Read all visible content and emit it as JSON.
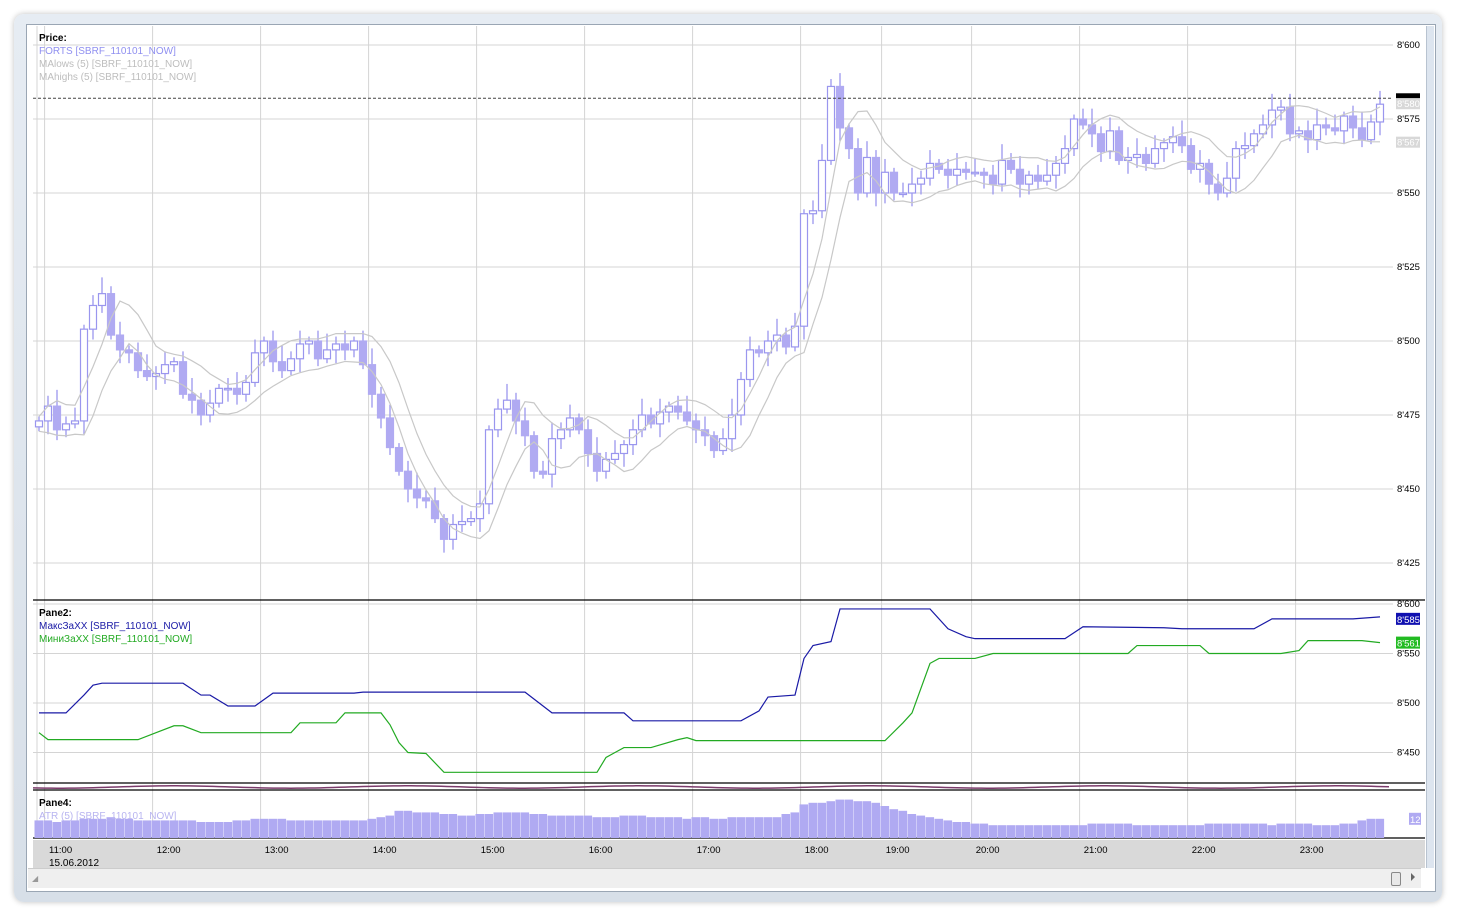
{
  "colors": {
    "candle_up_stroke": "#9a96ee",
    "candle_down_fill": "#b0aaf2",
    "ma": "#c8c8c8",
    "max_line": "#1a1aa6",
    "min_line": "#22aa22",
    "atr": "#b0aaf2",
    "grid": "#d4d4d4"
  },
  "legends": {
    "price": {
      "title": "Price:",
      "items": [
        "FORTS [SBRF_110101_NOW]",
        "MAlows (5) [SBRF_110101_NOW]",
        "MAhighs (5) [SBRF_110101_NOW]"
      ]
    },
    "pane2": {
      "title": "Pane2:",
      "items": [
        "МаксЗаXX [SBRF_110101_NOW]",
        "МиниЗаXX [SBRF_110101_NOW]"
      ]
    },
    "pane4": {
      "title": "Pane4:",
      "items": [
        "ATR (5) [SBRF_110101_NOW]"
      ]
    }
  },
  "chart_data": [
    {
      "type": "candlestick",
      "name": "Price",
      "y_ticks": [
        "8'600",
        "8'575",
        "8'550",
        "8'525",
        "8'500",
        "8'475",
        "8'450",
        "8'425"
      ],
      "y_tick_values": [
        8600,
        8575,
        8550,
        8525,
        8500,
        8475,
        8450,
        8425
      ],
      "ylim": [
        8418,
        8606
      ],
      "current_price": 8582,
      "markers": [
        {
          "label": "8'580",
          "value": 8580
        },
        {
          "label": "8'575",
          "value": 8575
        },
        {
          "label": "8'567",
          "value": 8567
        }
      ],
      "close": [
        8473,
        8478,
        8470,
        8472,
        8473,
        8504,
        8512,
        8516,
        8502,
        8497,
        8496,
        8490,
        8488,
        8489,
        8492,
        8493,
        8482,
        8480,
        8475,
        8479,
        8484,
        8484,
        8482,
        8486,
        8496,
        8500,
        8493,
        8490,
        8494,
        8499,
        8500,
        8494,
        8497,
        8499,
        8497,
        8500,
        8492,
        8482,
        8474,
        8464,
        8456,
        8450,
        8447,
        8446,
        8440,
        8433,
        8438,
        8439,
        8440,
        8445,
        8470,
        8477,
        8480,
        8473,
        8468,
        8456,
        8455,
        8467,
        8470,
        8474,
        8470,
        8462,
        8456,
        8460,
        8462,
        8465,
        8470,
        8475,
        8472,
        8476,
        8478,
        8476,
        8473,
        8470,
        8468,
        8463,
        8467,
        8475,
        8487,
        8497,
        8496,
        8500,
        8502,
        8498,
        8505,
        8543,
        8544,
        8561,
        8586,
        8572,
        8565,
        8550,
        8562,
        8550,
        8557,
        8550,
        8550,
        8553,
        8555,
        8560,
        8558,
        8556,
        8558,
        8557,
        8557,
        8556,
        8553,
        8561,
        8558,
        8553,
        8556,
        8554,
        8556,
        8560,
        8565,
        8575,
        8573,
        8570,
        8564,
        8571,
        8561,
        8562,
        8563,
        8560,
        8565,
        8567,
        8569,
        8566,
        8558,
        8560,
        8553,
        8550,
        8555,
        8565,
        8566,
        8570,
        8573,
        8578,
        8579,
        8570,
        8571,
        8568,
        8573,
        8572,
        8571,
        8576,
        8572,
        8568,
        8574,
        8580
      ]
    },
    {
      "type": "line",
      "name": "Pane2",
      "y_ticks": [
        "8'600",
        "8'550",
        "8'500",
        "8'450"
      ],
      "y_tick_values": [
        8600,
        8550,
        8500,
        8450
      ],
      "markers": [
        {
          "label": "8'585",
          "value": 8585,
          "series": 0
        },
        {
          "label": "8'561",
          "value": 8561,
          "series": 1
        }
      ],
      "series": [
        {
          "name": "МаксЗаXX",
          "points": [
            [
              0,
              8490
            ],
            [
              3,
              8490
            ],
            [
              5,
              8508
            ],
            [
              6,
              8518
            ],
            [
              7,
              8520
            ],
            [
              16,
              8520
            ],
            [
              18,
              8508
            ],
            [
              19,
              8508
            ],
            [
              21,
              8497
            ],
            [
              24,
              8497
            ],
            [
              26,
              8510
            ],
            [
              35,
              8510
            ],
            [
              36,
              8511
            ],
            [
              54,
              8511
            ],
            [
              57,
              8490
            ],
            [
              65,
              8490
            ],
            [
              66,
              8482
            ],
            [
              78,
              8482
            ],
            [
              80,
              8492
            ],
            [
              81,
              8506
            ],
            [
              84,
              8508
            ],
            [
              85,
              8545
            ],
            [
              86,
              8558
            ],
            [
              88,
              8562
            ],
            [
              89,
              8595
            ],
            [
              99,
              8595
            ],
            [
              101,
              8575
            ],
            [
              103,
              8567
            ],
            [
              104,
              8565
            ],
            [
              114,
              8565
            ],
            [
              116,
              8577
            ],
            [
              125,
              8576
            ],
            [
              127,
              8575
            ],
            [
              135,
              8575
            ],
            [
              137,
              8585
            ],
            [
              146,
              8585
            ],
            [
              149,
              8587
            ]
          ]
        },
        {
          "name": "МиниЗаXX",
          "points": [
            [
              0,
              8470
            ],
            [
              1,
              8463
            ],
            [
              11,
              8463
            ],
            [
              13,
              8470
            ],
            [
              15,
              8477
            ],
            [
              16,
              8477
            ],
            [
              18,
              8470
            ],
            [
              28,
              8470
            ],
            [
              29,
              8480
            ],
            [
              33,
              8480
            ],
            [
              34,
              8490
            ],
            [
              38,
              8490
            ],
            [
              39,
              8478
            ],
            [
              40,
              8460
            ],
            [
              41,
              8450
            ],
            [
              43,
              8449
            ],
            [
              45,
              8430
            ],
            [
              62,
              8430
            ],
            [
              63,
              8445
            ],
            [
              64,
              8450
            ],
            [
              65,
              8455
            ],
            [
              68,
              8455
            ],
            [
              71,
              8463
            ],
            [
              72,
              8465
            ],
            [
              73,
              8462
            ],
            [
              94,
              8462
            ],
            [
              96,
              8480
            ],
            [
              97,
              8490
            ],
            [
              99,
              8540
            ],
            [
              100,
              8545
            ],
            [
              104,
              8545
            ],
            [
              106,
              8550
            ],
            [
              115,
              8550
            ],
            [
              121,
              8550
            ],
            [
              122,
              8558
            ],
            [
              129,
              8558
            ],
            [
              130,
              8550
            ],
            [
              138,
              8550
            ],
            [
              140,
              8553
            ],
            [
              141,
              8563
            ],
            [
              147,
              8563
            ],
            [
              149,
              8561
            ]
          ]
        }
      ]
    },
    {
      "type": "bar",
      "name": "Pane4 ATR (5)",
      "marker": {
        "label": "12",
        "value": 12
      },
      "values": [
        11,
        11,
        10,
        11,
        11,
        12,
        12,
        12,
        13,
        12,
        12,
        11,
        11,
        11,
        11,
        11,
        11,
        11,
        10,
        10,
        10,
        10,
        11,
        11,
        12,
        12,
        12,
        12,
        11,
        11,
        11,
        11,
        11,
        11,
        11,
        11,
        11,
        12,
        13,
        14,
        17,
        17,
        16,
        16,
        16,
        15,
        15,
        14,
        14,
        15,
        15,
        16,
        16,
        16,
        16,
        15,
        15,
        14,
        14,
        14,
        14,
        14,
        13,
        13,
        13,
        14,
        14,
        14,
        13,
        13,
        13,
        13,
        12,
        13,
        13,
        12,
        12,
        13,
        13,
        13,
        13,
        13,
        13,
        15,
        16,
        21,
        22,
        22,
        23,
        24,
        24,
        23,
        23,
        22,
        20,
        18,
        17,
        15,
        14,
        13,
        12,
        11,
        10,
        10,
        9,
        9,
        8,
        8,
        8,
        8,
        8,
        8,
        8,
        8,
        8,
        8,
        8,
        9,
        9,
        9,
        9,
        9,
        8,
        8,
        8,
        8,
        8,
        8,
        8,
        8,
        9,
        9,
        9,
        9,
        9,
        9,
        9,
        8,
        9,
        9,
        9,
        9,
        8,
        8,
        8,
        9,
        9,
        11,
        12,
        12
      ]
    }
  ],
  "x_axis": {
    "date": "15.06.2012",
    "ticks": [
      {
        "label": "11:00",
        "bar": 2.4
      },
      {
        "label": "12:00",
        "bar": 14.4
      },
      {
        "label": "13:00",
        "bar": 26.4
      },
      {
        "label": "14:00",
        "bar": 38.4
      },
      {
        "label": "15:00",
        "bar": 50.4
      },
      {
        "label": "16:00",
        "bar": 62.4
      },
      {
        "label": "17:00",
        "bar": 74.4
      },
      {
        "label": "18:00",
        "bar": 86.4
      },
      {
        "label": "19:00",
        "bar": 95.4
      },
      {
        "label": "20:00",
        "bar": 105.4
      },
      {
        "label": "21:00",
        "bar": 117.4
      },
      {
        "label": "22:00",
        "bar": 129.4
      },
      {
        "label": "23:00",
        "bar": 141.4
      }
    ]
  }
}
